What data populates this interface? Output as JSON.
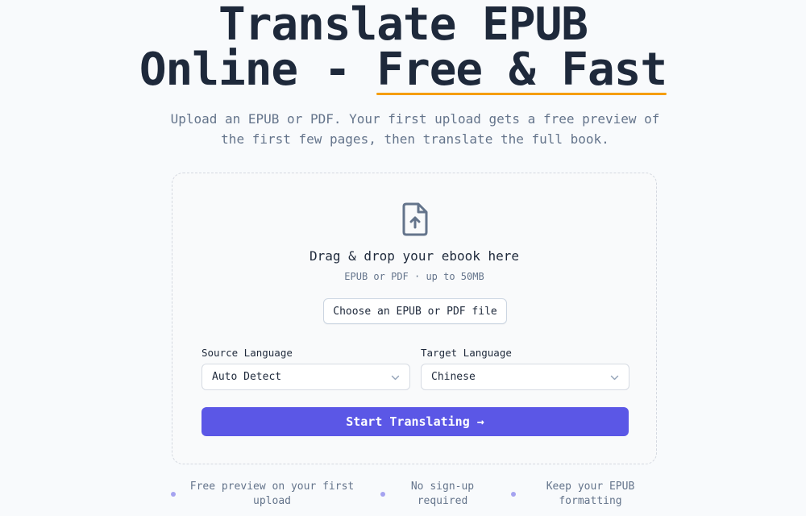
{
  "hero": {
    "title_line1": "Translate EPUB",
    "title_line2_prefix": "Online - ",
    "title_highlight": "Free & Fast",
    "subtitle": "Upload an EPUB or PDF. Your first upload gets a free preview of the first few pages, then translate the full book."
  },
  "upload": {
    "icon": "file-upload-icon",
    "drop_text": "Drag & drop your ebook here",
    "hint": "EPUB or PDF · up to 50MB",
    "choose_label": "Choose an EPUB or PDF file"
  },
  "languages": {
    "source_label": "Source Language",
    "source_value": "Auto Detect",
    "target_label": "Target Language",
    "target_value": "Chinese"
  },
  "actions": {
    "start_label": "Start Translating →"
  },
  "features": [
    "Free preview on your first upload",
    "No sign-up required",
    "Keep your EPUB formatting"
  ],
  "colors": {
    "accent": "#5b57e6",
    "highlight_underline": "#f59e0b",
    "bullet": "#a5a3f0"
  }
}
